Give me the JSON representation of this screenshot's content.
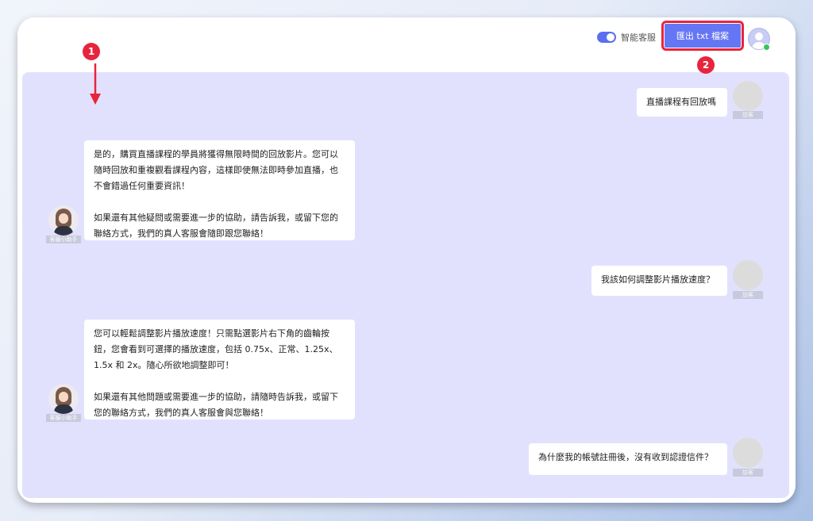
{
  "header": {
    "toggle_label": "智能客服",
    "toggle_on": true,
    "export_button_label": "匯出 txt 檔案"
  },
  "labels": {
    "visitor": "訪客",
    "assistant": "客服小助手"
  },
  "annotations": {
    "marker_1": "1",
    "marker_2": "2"
  },
  "messages": [
    {
      "role": "visitor",
      "text": "直播課程有回放嗎"
    },
    {
      "role": "assistant",
      "paragraphs": [
        "是的，購買直播課程的學員將獲得無限時間的回放影片。您可以隨時回放和重複觀看課程內容，這樣即使無法即時參加直播，也不會錯過任何重要資訊！",
        "如果還有其他疑問或需要進一步的協助，請告訴我，或留下您的聯絡方式，我們的真人客服會隨即跟您聯絡！"
      ]
    },
    {
      "role": "visitor",
      "text": "我該如何調整影片播放速度？"
    },
    {
      "role": "assistant",
      "paragraphs": [
        "您可以輕鬆調整影片播放速度！只需點選影片右下角的齒輪按鈕，您會看到可選擇的播放速度，包括 0.75x、正常、1.25x、1.5x 和 2x。隨心所欲地調整即可！",
        "如果還有其他問題或需要進一步的協助，請隨時告訴我，或留下您的聯絡方式，我們的真人客服會與您聯絡！"
      ]
    },
    {
      "role": "visitor",
      "text": "為什麼我的帳號註冊後，沒有收到認證信件？"
    }
  ],
  "colors": {
    "accent": "#6576f5",
    "highlight": "#e8243c",
    "chat_bg": "#e2e1fd"
  }
}
